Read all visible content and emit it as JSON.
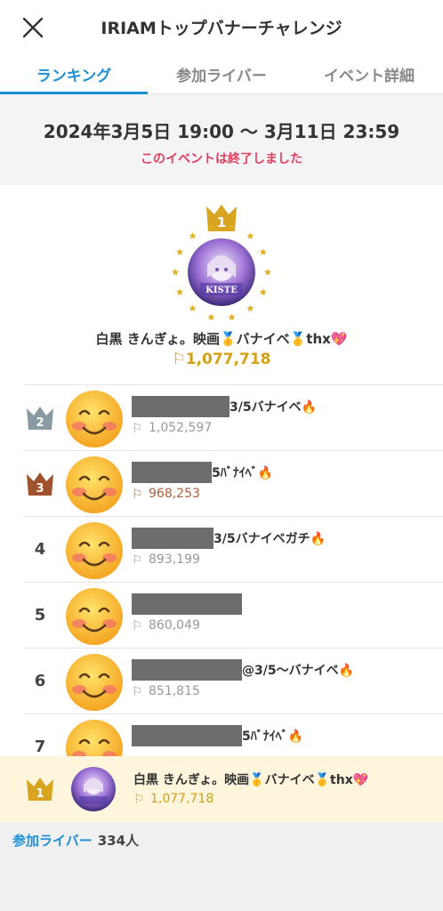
{
  "header": {
    "title": "IRIAMトップバナーチャレンジ",
    "close_icon": "close-icon"
  },
  "tabs": [
    {
      "label": "ランキング",
      "active": true
    },
    {
      "label": "参加ライバー",
      "active": false
    },
    {
      "label": "イベント詳細",
      "active": false
    }
  ],
  "event": {
    "period": "2024年3月5日 19:00 〜 3月11日 23:59",
    "status": "このイベントは終了しました"
  },
  "top1": {
    "rank": "1",
    "name": "白黒 きんぎょ。映画🥇バナイベ🥇thx💖",
    "score": "1,077,718"
  },
  "rankings": [
    {
      "rank": "2",
      "name_suffix": "3/5バナイベ🔥",
      "score": "1,052,597",
      "crown": "silver"
    },
    {
      "rank": "3",
      "name_suffix": "5ﾊﾞﾅｲﾍﾞ🔥",
      "score": "968,253",
      "crown": "bronze"
    },
    {
      "rank": "4",
      "name_suffix": "3/5バナイベガチ🔥",
      "score": "893,199",
      "crown": ""
    },
    {
      "rank": "5",
      "name_suffix": "",
      "score": "860,049",
      "crown": ""
    },
    {
      "rank": "6",
      "name_suffix": "@3/5〜バナイベ🔥",
      "score": "851,815",
      "crown": ""
    },
    {
      "rank": "7",
      "name_suffix": "5ﾊﾞﾅｲﾍﾞ🔥",
      "score": "",
      "crown": ""
    }
  ],
  "self_row": {
    "rank": "1",
    "name": "白黒 きんぎょ。映画🥇バナイベ🥇thx💖",
    "score": "1,077,718"
  },
  "footer": {
    "participants_label": "参加ライバー",
    "participants_count": "334人"
  },
  "colors": {
    "accent": "#1c8fd6",
    "gold": "#d4a017",
    "silver": "#8a9aa3",
    "bronze": "#a0522d",
    "ended_red": "#e0405e"
  }
}
